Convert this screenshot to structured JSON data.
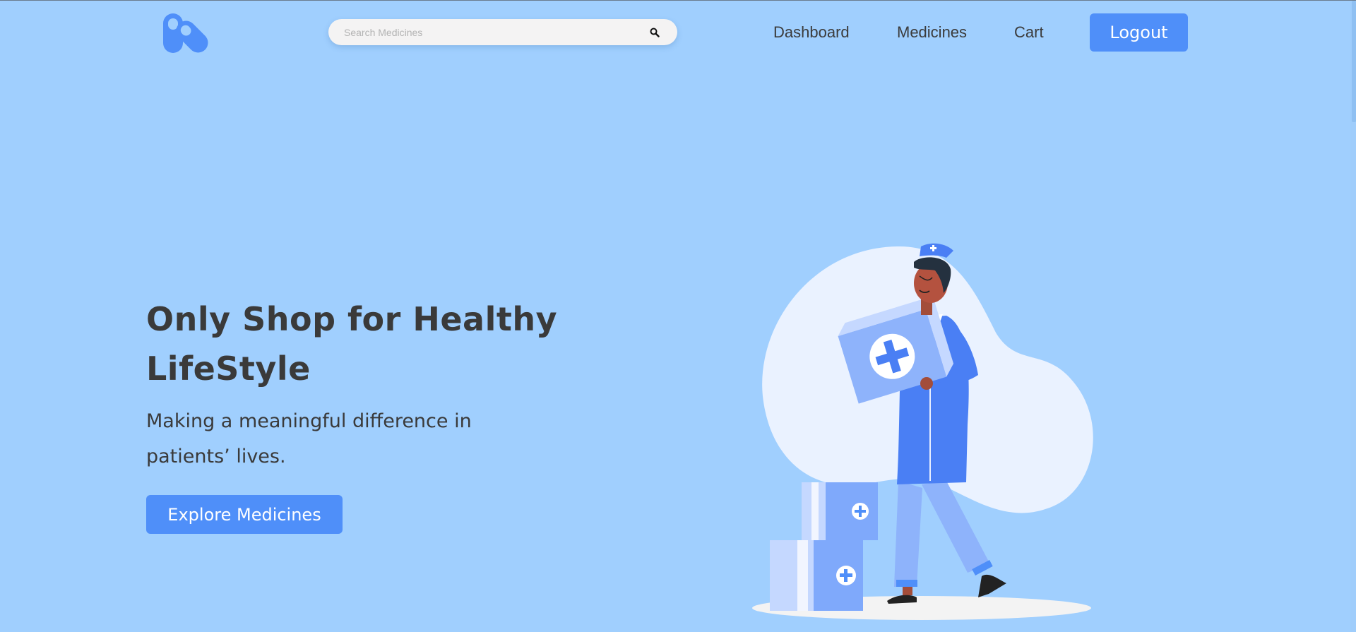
{
  "header": {
    "search": {
      "placeholder": "Search Medicines",
      "icon": "search-icon"
    },
    "nav": {
      "dashboard": "Dashboard",
      "medicines": "Medicines",
      "cart": "Cart",
      "logout": "Logout"
    },
    "logo_icon": "pills-logo-icon"
  },
  "hero": {
    "title": "Only Shop for Healthy LifeStyle",
    "subtitle": "Making a meaningful difference in patients’ lives.",
    "cta": "Explore Medicines",
    "illustration": "pharmacist-carrying-medicine-boxes"
  },
  "colors": {
    "background": "#a0cffe",
    "accent": "#4f8ff9",
    "text": "#3a3a3a",
    "search_bg": "#f4f3f3"
  }
}
